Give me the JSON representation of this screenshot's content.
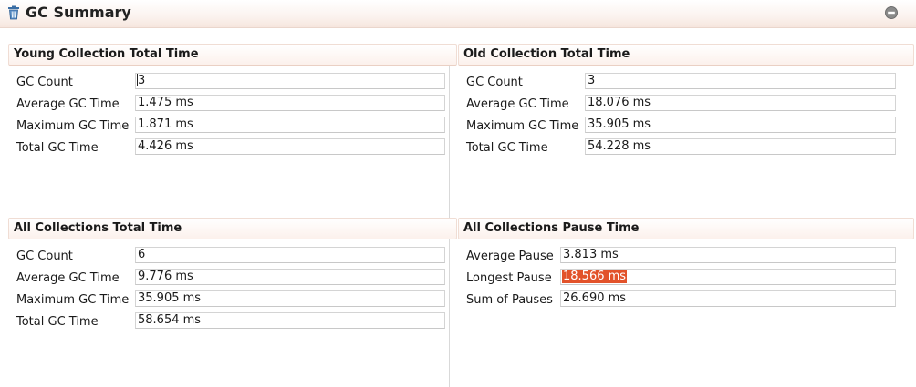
{
  "title": "GC Summary",
  "icons": {
    "title": "trash-icon",
    "collapse": "collapse-icon"
  },
  "colors": {
    "highlight": "#e2522a"
  },
  "panels": {
    "young": {
      "title": "Young Collection Total Time",
      "rows": [
        {
          "label": "GC Count",
          "value": "3"
        },
        {
          "label": "Average GC Time",
          "value": "1.475 ms"
        },
        {
          "label": "Maximum GC Time",
          "value": "1.871 ms"
        },
        {
          "label": "Total GC Time",
          "value": "4.426 ms"
        }
      ]
    },
    "old": {
      "title": "Old Collection Total Time",
      "rows": [
        {
          "label": "GC Count",
          "value": "3"
        },
        {
          "label": "Average GC Time",
          "value": "18.076 ms"
        },
        {
          "label": "Maximum GC Time",
          "value": "35.905 ms"
        },
        {
          "label": "Total GC Time",
          "value": "54.228 ms"
        }
      ]
    },
    "all": {
      "title": "All Collections Total Time",
      "rows": [
        {
          "label": "GC Count",
          "value": "6"
        },
        {
          "label": "Average GC Time",
          "value": "9.776 ms"
        },
        {
          "label": "Maximum GC Time",
          "value": "35.905 ms"
        },
        {
          "label": "Total GC Time",
          "value": "58.654 ms"
        }
      ]
    },
    "pause": {
      "title": "All Collections Pause Time",
      "rows": [
        {
          "label": "Average Pause",
          "value": "3.813 ms"
        },
        {
          "label": "Longest Pause",
          "value": "18.566 ms"
        },
        {
          "label": "Sum of Pauses",
          "value": "26.690 ms"
        }
      ]
    }
  }
}
